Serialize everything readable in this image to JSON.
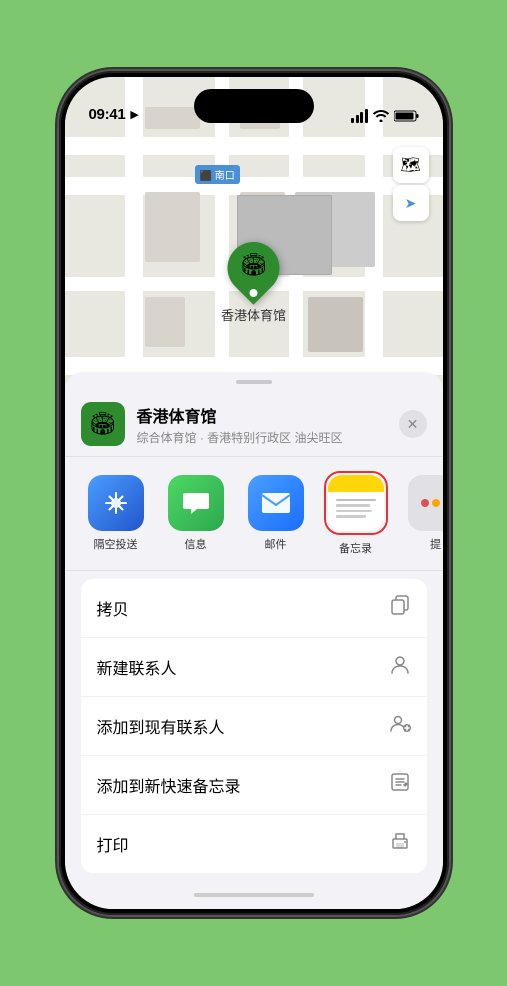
{
  "status_bar": {
    "time": "09:41",
    "location_icon": "▶"
  },
  "map": {
    "south_gate_label": "南口",
    "south_gate_prefix": "⬛",
    "marker_label": "香港体育馆",
    "marker_emoji": "🏟"
  },
  "map_controls": {
    "map_type_icon": "🗺",
    "location_icon": "➤"
  },
  "sheet": {
    "venue_emoji": "🏟",
    "venue_name": "香港体育馆",
    "venue_subtitle": "综合体育馆 · 香港特别行政区 油尖旺区",
    "close_label": "✕"
  },
  "share_items": [
    {
      "label": "隔空投送",
      "type": "airdrop"
    },
    {
      "label": "信息",
      "type": "message"
    },
    {
      "label": "邮件",
      "type": "mail"
    },
    {
      "label": "备忘录",
      "type": "notes"
    },
    {
      "label": "提",
      "type": "more"
    }
  ],
  "action_rows": [
    {
      "label": "拷贝",
      "icon": "⎘"
    },
    {
      "label": "新建联系人",
      "icon": "👤"
    },
    {
      "label": "添加到现有联系人",
      "icon": "👤+"
    },
    {
      "label": "添加到新快速备忘录",
      "icon": "📋"
    },
    {
      "label": "打印",
      "icon": "🖨"
    }
  ]
}
